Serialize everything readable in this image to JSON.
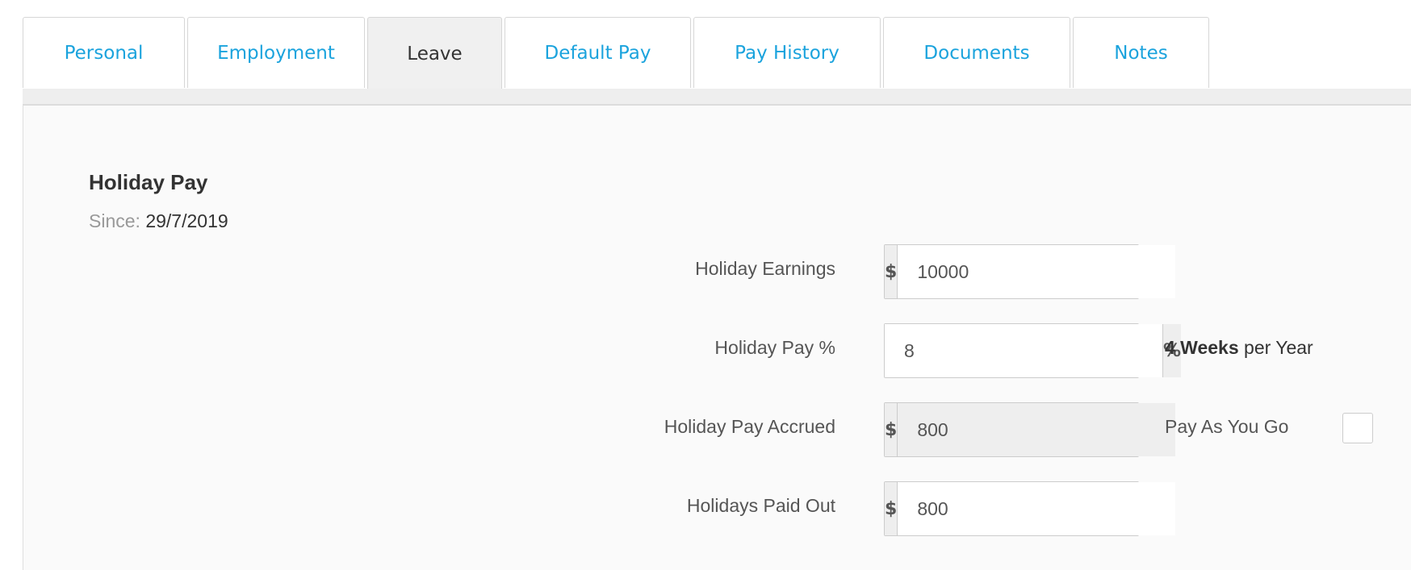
{
  "tabs": [
    {
      "label": "Personal",
      "active": false
    },
    {
      "label": "Employment",
      "active": false
    },
    {
      "label": "Leave",
      "active": true
    },
    {
      "label": "Default Pay",
      "active": false
    },
    {
      "label": "Pay History",
      "active": false
    },
    {
      "label": "Documents",
      "active": false
    },
    {
      "label": "Notes",
      "active": false
    }
  ],
  "holiday_pay": {
    "title": "Holiday Pay",
    "since_label": "Since:",
    "since_value": "29/7/2019",
    "fields": {
      "earnings": {
        "label": "Holiday Earnings",
        "prefix": "$",
        "value": "10000"
      },
      "pay_percent": {
        "label": "Holiday Pay %",
        "suffix": "%",
        "value": "8"
      },
      "accrued": {
        "label": "Holiday Pay Accrued",
        "prefix": "$",
        "value": "800"
      },
      "paid_out": {
        "label": "Holidays Paid Out",
        "prefix": "$",
        "value": "800"
      }
    },
    "weeks_strong": "4 Weeks",
    "weeks_rest": " per Year",
    "pay_as_you_go_label": "Pay As You Go",
    "pay_as_you_go_checked": false
  },
  "colors": {
    "tab_link": "#1ba3dd",
    "active_tab_bg": "#f0f0f0",
    "panel_bg": "#fafafa"
  }
}
